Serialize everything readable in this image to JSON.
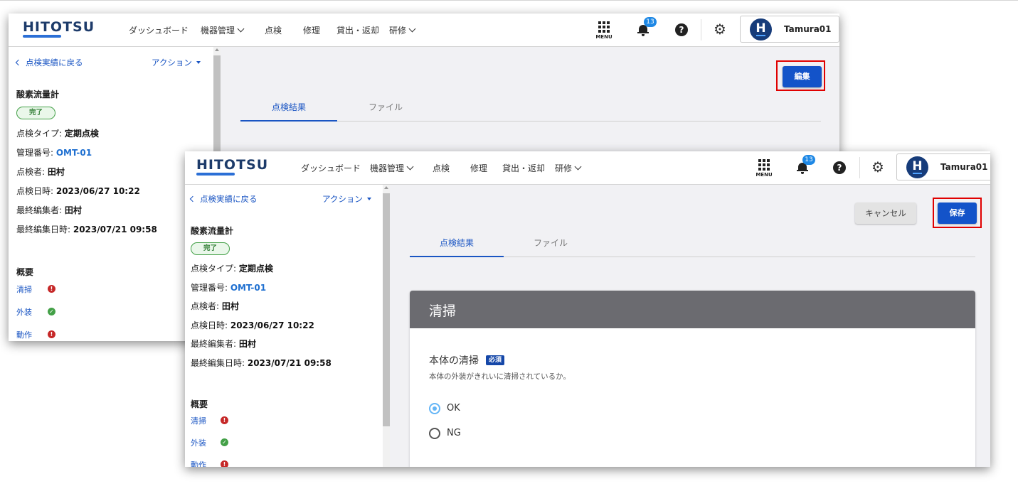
{
  "header": {
    "logo": "HITOTSU",
    "nav": {
      "dashboard": "ダッシュボード",
      "equipment": "機器管理",
      "inspection": "点検",
      "repair": "修理",
      "lending": "貸出・返却",
      "training": "研修"
    },
    "menu_label": "MENU",
    "notification_count": "13",
    "help_glyph": "?",
    "user_initial": "H",
    "user_name": "Tamura01"
  },
  "sidebar": {
    "back_link": "点検実績に戻る",
    "action": "アクション",
    "equipment_name": "酸素流量計",
    "status": "完了",
    "fields": [
      {
        "label": "点検タイプ: ",
        "value": "定期点検"
      },
      {
        "label": "管理番号: ",
        "value": "OMT-01"
      },
      {
        "label": "点検者: ",
        "value": "田村"
      },
      {
        "label": "点検日時: ",
        "value": "2023/06/27 10:22"
      },
      {
        "label": "最終編集者: ",
        "value": "田村"
      },
      {
        "label": "最終編集日時: ",
        "value": "2023/07/21 09:58"
      }
    ],
    "overview_title": "概要",
    "overview": [
      {
        "label": "清掃",
        "state": "error",
        "glyph": "!"
      },
      {
        "label": "外装",
        "state": "ok",
        "glyph": "✓"
      },
      {
        "label": "動作",
        "state": "error",
        "glyph": "!"
      }
    ]
  },
  "tabs": {
    "results": "点検結果",
    "files": "ファイル"
  },
  "buttons": {
    "edit": "編集",
    "cancel": "キャンセル",
    "save": "保存"
  },
  "section": {
    "title": "清掃",
    "question": "本体の清掃",
    "required": "必須",
    "description": "本体の外装がきれいに清掃されているか。",
    "options": [
      "OK",
      "NG"
    ],
    "selected": "OK"
  },
  "colors": {
    "brand_navy": "#173c7a",
    "primary_button": "#1353c9",
    "highlight_box": "#e00000",
    "status_green": "#43a047",
    "error_red": "#c62828"
  }
}
